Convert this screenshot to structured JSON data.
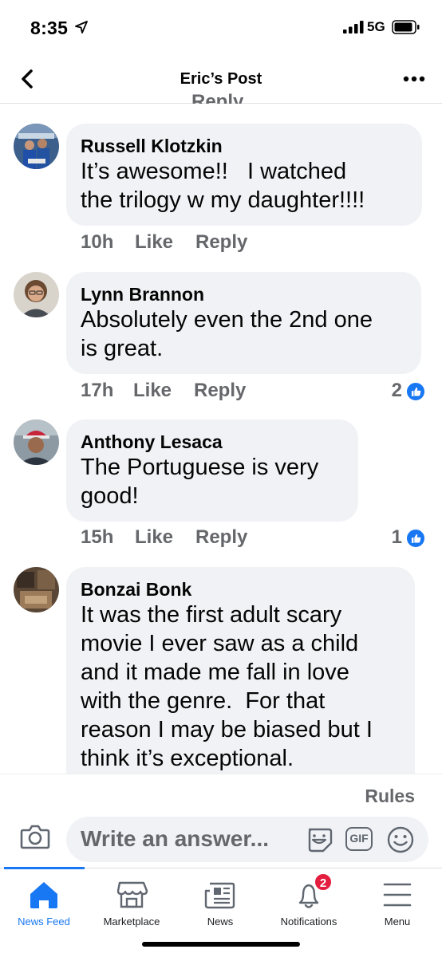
{
  "status_bar": {
    "time": "8:35",
    "network": "5G"
  },
  "header": {
    "title": "Eric’s Post"
  },
  "cutoff_reply": "Reply",
  "comments": [
    {
      "name": "Russell Klotzkin",
      "lines": [
        "It’s awesome!!   I watched",
        "the trilogy w my daughter!!!!"
      ],
      "time": "10h",
      "like": "Like",
      "reply": "Reply",
      "reactions": ""
    },
    {
      "name": "Lynn Brannon",
      "lines": [
        "Absolutely even the 2nd one",
        "is great."
      ],
      "time": "17h",
      "like": "Like",
      "reply": "Reply",
      "reactions": "2"
    },
    {
      "name": "Anthony Lesaca",
      "lines": [
        "The Portuguese is very",
        "good!"
      ],
      "time": "15h",
      "like": "Like",
      "reply": "Reply",
      "reactions": "1"
    },
    {
      "name": "Bonzai Bonk",
      "lines": [
        "It was the first adult scary",
        "movie I ever saw as a child",
        "and it made me fall in love",
        "with the genre.  For that",
        "reason I may be biased but I",
        "think it’s exceptional."
      ]
    }
  ],
  "composer": {
    "rules": "Rules",
    "placeholder": "Write an answer...",
    "gif_label": "GIF"
  },
  "tabs": [
    {
      "label": "News Feed",
      "icon": "home-icon"
    },
    {
      "label": "Marketplace",
      "icon": "marketplace-icon"
    },
    {
      "label": "News",
      "icon": "news-icon"
    },
    {
      "label": "Notifications",
      "icon": "bell-icon",
      "badge": "2"
    },
    {
      "label": "Menu",
      "icon": "menu-icon"
    }
  ],
  "colors": {
    "accent": "#1877f2",
    "bubble": "#f0f2f5",
    "muted": "#65676b",
    "badge": "#e41e3f"
  }
}
